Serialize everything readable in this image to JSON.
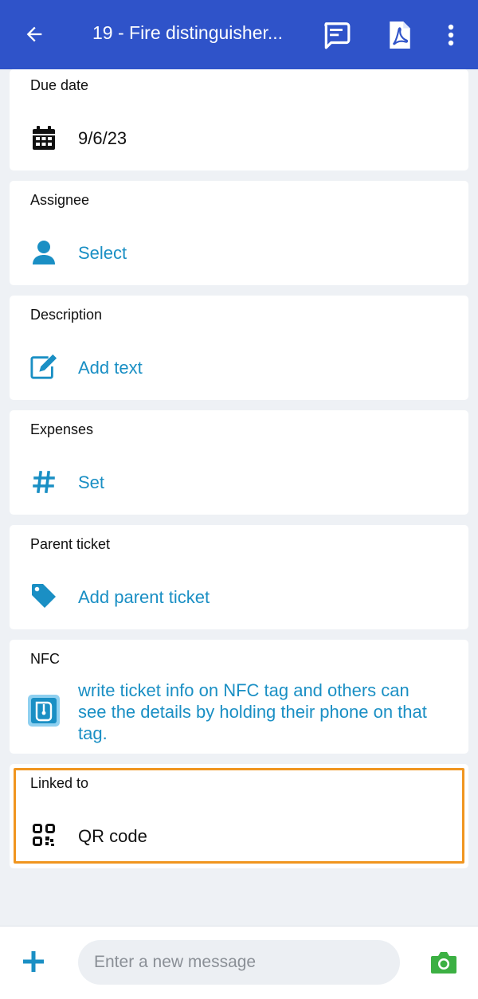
{
  "header": {
    "title": "19 - Fire distinguisher...",
    "icons": [
      "back-arrow-icon",
      "comment-icon",
      "pdf-icon",
      "more-vert-icon"
    ]
  },
  "cards": {
    "due_date": {
      "label": "Due date",
      "value": "9/6/23",
      "icon": "calendar-icon"
    },
    "assignee": {
      "label": "Assignee",
      "value": "Select",
      "icon": "person-icon"
    },
    "description": {
      "label": "Description",
      "value": "Add text",
      "icon": "edit-icon"
    },
    "expenses": {
      "label": "Expenses",
      "value": "Set",
      "icon": "hash-icon"
    },
    "parent_ticket": {
      "label": "Parent ticket",
      "value": "Add parent ticket",
      "icon": "tag-icon"
    },
    "nfc": {
      "label": "NFC",
      "line1": "write ticket info on NFC tag and others can",
      "line2": "see the details by holding their phone on that",
      "line3": "tag.",
      "icon": "nfc-icon"
    },
    "linked_to": {
      "label": "Linked to",
      "value": "QR code",
      "icon": "qr-code-icon"
    }
  },
  "composer": {
    "placeholder": "Enter a new message",
    "icons": [
      "plus-icon",
      "camera-icon"
    ]
  },
  "colors": {
    "appbar": "#2f53c9",
    "link": "#1a8fc4",
    "highlight": "#f0951f",
    "camera": "#3cb043"
  }
}
